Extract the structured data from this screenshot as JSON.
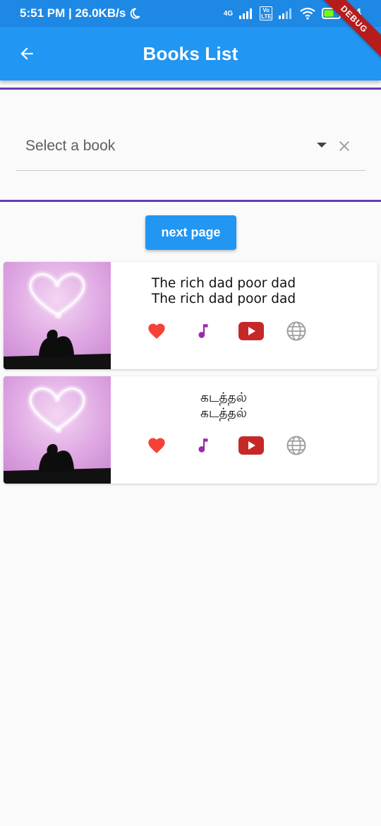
{
  "status_bar": {
    "time_speed": "5:51 PM | 26.0KB/s",
    "network_tag": "4G",
    "volte_tag": "Vo LTE",
    "battery": "64"
  },
  "debug_banner": "DEBUG",
  "app_bar": {
    "title": "Books List"
  },
  "dropdown": {
    "placeholder": "Select a book"
  },
  "next_button": {
    "label": "next page"
  },
  "books": [
    {
      "title_line1": "The rich dad poor dad",
      "title_line2": "The rich dad poor dad"
    },
    {
      "title_line1": "கடத்தல்",
      "title_line2": "கடத்தல்"
    }
  ],
  "colors": {
    "app_bar": "#2196f3",
    "status_bar": "#1e88e5",
    "divider": "#673ab7",
    "heart": "#f44336",
    "music": "#9c27b0",
    "youtube": "#c62828",
    "globe": "#9e9e9e"
  },
  "icons": [
    "back-arrow-icon",
    "moon-icon",
    "signal-icon",
    "wifi-icon",
    "battery-icon",
    "dropdown-arrow-icon",
    "clear-icon",
    "heart-icon",
    "music-note-icon",
    "youtube-icon",
    "globe-icon"
  ]
}
